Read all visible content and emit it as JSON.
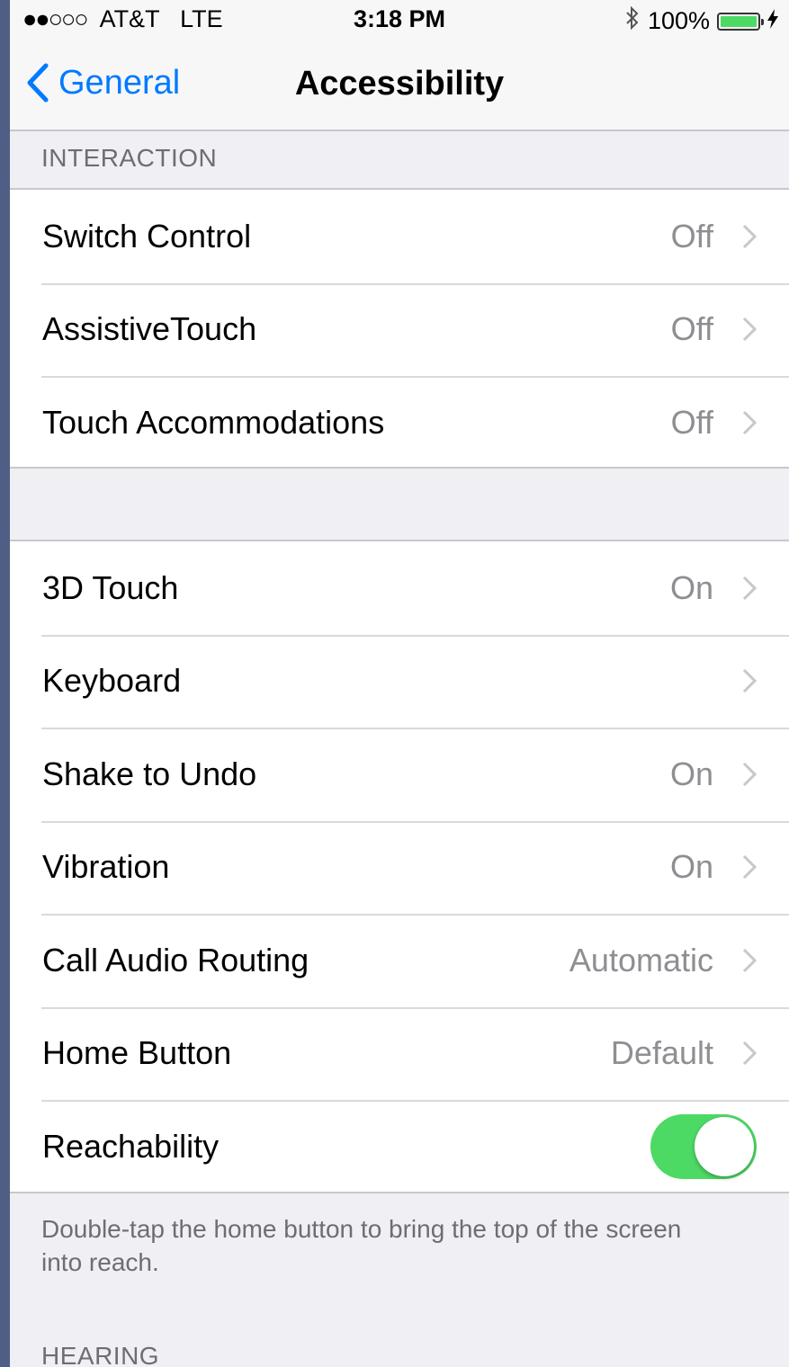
{
  "status_bar": {
    "signal": "●●○○○",
    "carrier": "AT&T",
    "network": "LTE",
    "time": "3:18 PM",
    "bluetooth_icon": "bluetooth-icon",
    "battery_percent": "100%",
    "battery_level": 1.0,
    "charging_icon": "bolt-icon"
  },
  "navbar": {
    "back_label": "General",
    "title": "Accessibility"
  },
  "sections": {
    "interaction_header": "INTERACTION",
    "interaction_rows": [
      {
        "label": "Switch Control",
        "value": "Off"
      },
      {
        "label": "AssistiveTouch",
        "value": "Off"
      },
      {
        "label": "Touch Accommodations",
        "value": "Off"
      }
    ],
    "second_rows": [
      {
        "label": "3D Touch",
        "value": "On"
      },
      {
        "label": "Keyboard",
        "value": ""
      },
      {
        "label": "Shake to Undo",
        "value": "On"
      },
      {
        "label": "Vibration",
        "value": "On"
      },
      {
        "label": "Call Audio Routing",
        "value": "Automatic"
      },
      {
        "label": "Home Button",
        "value": "Default"
      }
    ],
    "reachability": {
      "label": "Reachability",
      "enabled": true
    },
    "reachability_note": "Double-tap the home button to bring the top of the screen into reach.",
    "hearing_header": "HEARING"
  },
  "colors": {
    "accent": "#007aff",
    "toggle_on": "#4cd964",
    "background": "#efeff4"
  }
}
